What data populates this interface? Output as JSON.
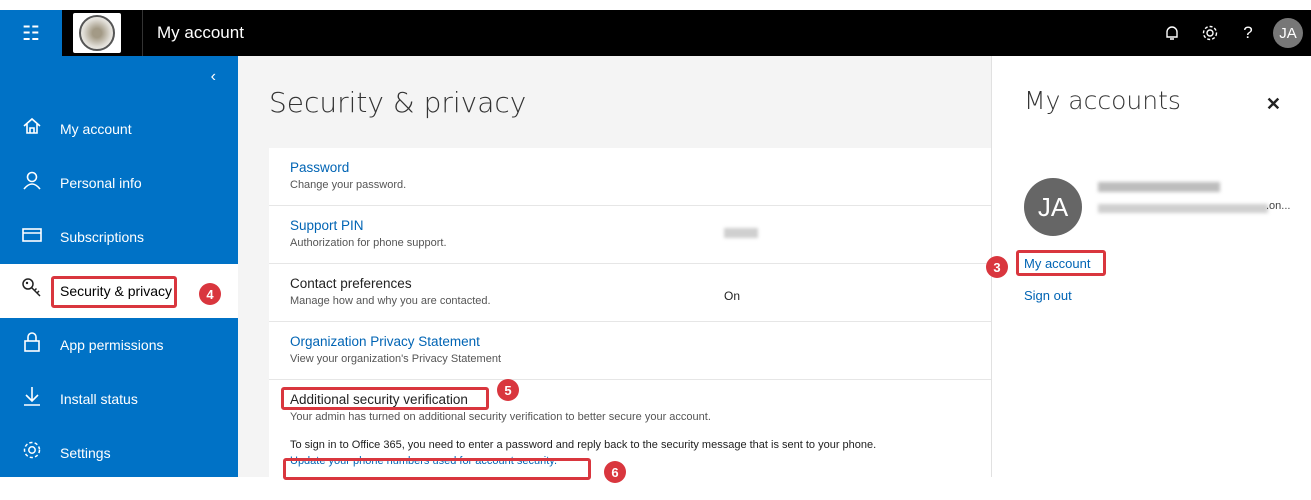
{
  "suitebar": {
    "app_title": "My account",
    "user_initials": "JA"
  },
  "sidebar": {
    "items": [
      {
        "label": "My account",
        "icon": "home-icon"
      },
      {
        "label": "Personal info",
        "icon": "person-icon"
      },
      {
        "label": "Subscriptions",
        "icon": "card-icon"
      },
      {
        "label": "Security & privacy",
        "icon": "key-icon"
      },
      {
        "label": "App permissions",
        "icon": "lock-icon"
      },
      {
        "label": "Install status",
        "icon": "download-icon"
      },
      {
        "label": "Settings",
        "icon": "gear-icon"
      }
    ]
  },
  "main": {
    "title": "Security & privacy",
    "rows": [
      {
        "title": "Password",
        "subtitle": "Change your password.",
        "value": ""
      },
      {
        "title": "Support PIN",
        "subtitle": "Authorization for phone support.",
        "value": ""
      },
      {
        "title": "Contact preferences",
        "subtitle": "Manage how and why you are contacted.",
        "value": "On"
      },
      {
        "title": "Organization Privacy Statement",
        "subtitle": "View your organization's Privacy Statement",
        "value": ""
      },
      {
        "title": "Additional security verification",
        "subtitle": "Your admin has turned on additional security verification to better secure your account.",
        "note": "To sign in to Office 365, you need to enter a password and reply back to the security message that is sent to your phone.",
        "link": "Update your phone numbers used for account security."
      }
    ]
  },
  "right_pane": {
    "title": "My accounts",
    "initials": "JA",
    "email_suffix": ".on...",
    "my_account_link": "My account",
    "sign_out_link": "Sign out"
  },
  "annotations": {
    "badge_3": "3",
    "badge_4": "4",
    "badge_5": "5",
    "badge_6": "6"
  },
  "colors": {
    "accent": "#0072c6",
    "highlight": "#d9363e"
  }
}
